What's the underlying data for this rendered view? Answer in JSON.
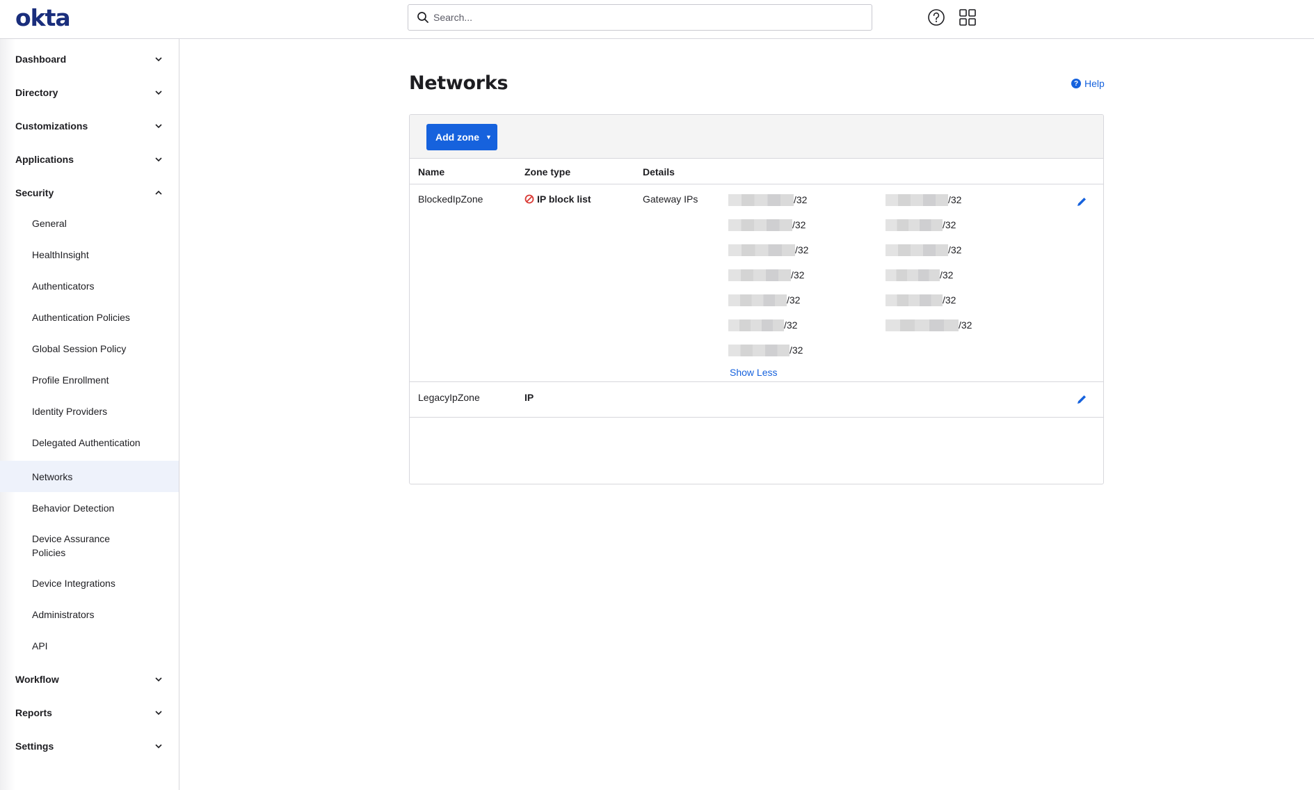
{
  "header": {
    "logo": "okta",
    "search_placeholder": "Search...",
    "help_icon": "help-circle-icon",
    "apps_icon": "app-grid-icon"
  },
  "sidebar": {
    "items": [
      {
        "label": "Dashboard",
        "expanded": false
      },
      {
        "label": "Directory",
        "expanded": false
      },
      {
        "label": "Customizations",
        "expanded": false
      },
      {
        "label": "Applications",
        "expanded": false
      },
      {
        "label": "Security",
        "expanded": true
      },
      {
        "label": "Workflow",
        "expanded": false
      },
      {
        "label": "Reports",
        "expanded": false
      },
      {
        "label": "Settings",
        "expanded": false
      }
    ],
    "security_sub": [
      {
        "label": "General"
      },
      {
        "label": "HealthInsight"
      },
      {
        "label": "Authenticators"
      },
      {
        "label": "Authentication Policies"
      },
      {
        "label": "Global Session Policy"
      },
      {
        "label": "Profile Enrollment"
      },
      {
        "label": "Identity Providers"
      },
      {
        "label": "Delegated Authentication"
      },
      {
        "label": "Networks",
        "active": true
      },
      {
        "label": "Behavior Detection"
      },
      {
        "label": "Device Assurance Policies"
      },
      {
        "label": "Device Integrations"
      },
      {
        "label": "Administrators"
      },
      {
        "label": "API"
      }
    ]
  },
  "main": {
    "title": "Networks",
    "help_label": "Help",
    "add_zone_label": "Add zone",
    "table": {
      "columns": [
        "Name",
        "Zone type",
        "Details"
      ],
      "rows": [
        {
          "name": "BlockedIpZone",
          "zone_type": "IP block list",
          "zone_type_icon": "block-icon",
          "details_label": "Gateway IPs",
          "ips_col1": [
            "[redacted]/32",
            "[redacted]/32",
            "[redacted]/32",
            "[redacted]/32",
            "[redacted]/32",
            "[redacted]/32",
            "[redacted]/32"
          ],
          "ips_col2": [
            "[redacted]/32",
            "[redacted]/32",
            "[redacted]/32",
            "[redacted]/32",
            "[redacted]/32",
            "[redacted]/32"
          ],
          "ip_suffix": "/32",
          "show_less_label": "Show Less"
        },
        {
          "name": "LegacyIpZone",
          "zone_type": "IP",
          "details_label": ""
        }
      ]
    }
  },
  "colors": {
    "brand": "#1a2e7c",
    "accent": "#1662dd",
    "danger": "#d93934",
    "active_nav_bg": "#eef2fb"
  }
}
